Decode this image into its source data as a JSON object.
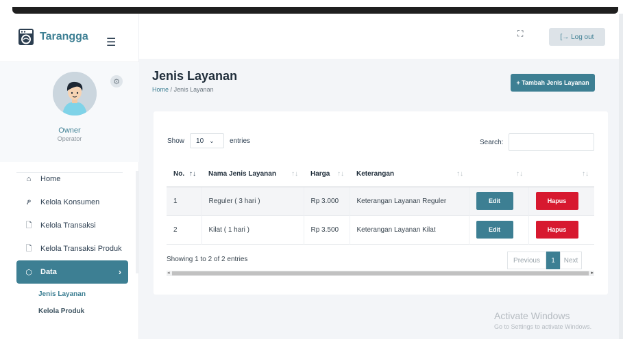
{
  "brand": {
    "name": "Tarangga",
    "menu_icon": "hamburger-icon"
  },
  "profile": {
    "role": "Owner",
    "subtitle": "Operator",
    "settings_icon": "gear-icon"
  },
  "nav": {
    "items": [
      {
        "label": "Home",
        "icon": "home-icon"
      },
      {
        "label": "Kelola Konsumen",
        "icon": "user-icon"
      },
      {
        "label": "Kelola Transaksi",
        "icon": "file-icon"
      },
      {
        "label": "Kelola Transaksi Produk",
        "icon": "file-icon"
      },
      {
        "label": "Data",
        "icon": "box-icon",
        "active": true
      }
    ],
    "sub_items": [
      {
        "label": "Jenis Layanan",
        "active": true
      },
      {
        "label": "Kelola Produk"
      }
    ]
  },
  "header": {
    "logout_label": "[→ Log out"
  },
  "page": {
    "title": "Jenis Layanan",
    "breadcrumb_home": "Home",
    "breadcrumb_sep": "/",
    "breadcrumb_current": "Jenis Layanan",
    "add_button": "+ Tambah Jenis Layanan"
  },
  "table_controls": {
    "show_label": "Show",
    "entries_value": "10",
    "entries_label": "entries",
    "search_label": "Search:"
  },
  "table": {
    "columns": [
      "No.",
      "Nama Jenis Layanan",
      "Harga",
      "Keterangan",
      "",
      ""
    ],
    "sort_glyph": "↑↓",
    "rows": [
      {
        "no": "1",
        "nama": "Reguler ( 3 hari )",
        "harga": "Rp 3.000",
        "keterangan": "Keterangan Layanan Reguler",
        "edit": "Edit",
        "hapus": "Hapus"
      },
      {
        "no": "2",
        "nama": "Kilat ( 1 hari )",
        "harga": "Rp 3.500",
        "keterangan": "Keterangan Layanan Kilat",
        "edit": "Edit",
        "hapus": "Hapus"
      }
    ]
  },
  "footer": {
    "info": "Showing 1 to 2 of 2 entries",
    "previous": "Previous",
    "current_page": "1",
    "next": "Next"
  },
  "watermark": {
    "line1": "Activate Windows",
    "line2": "Go to Settings to activate Windows."
  }
}
